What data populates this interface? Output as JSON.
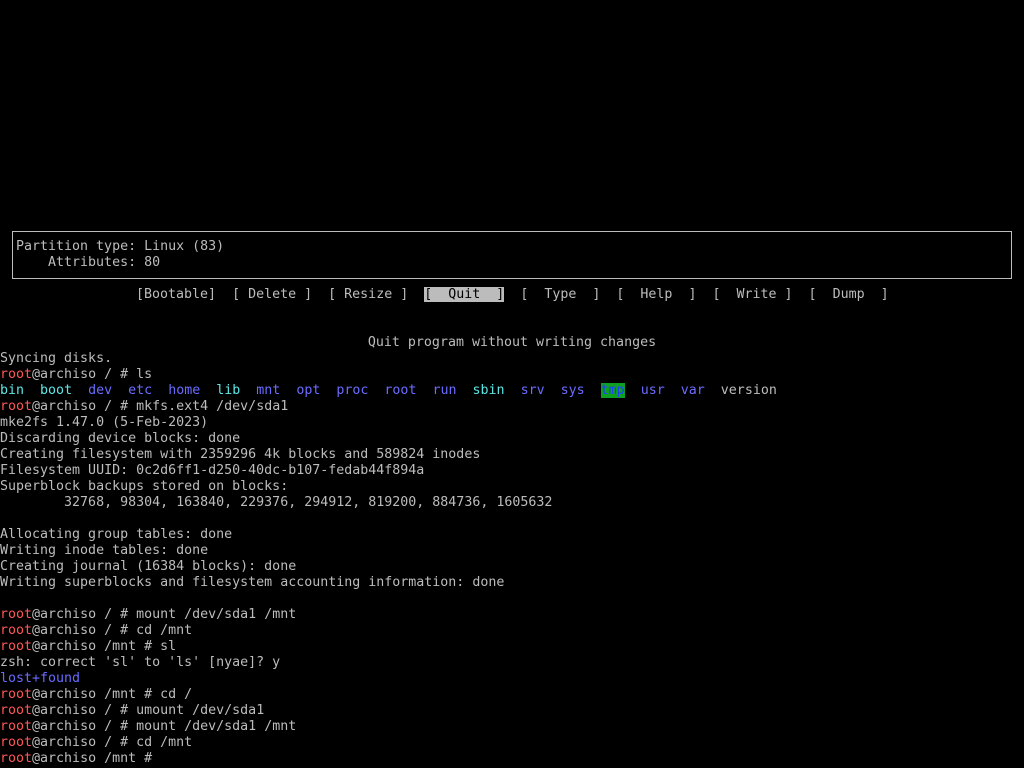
{
  "partition_info": {
    "type_line": "Partition type: Linux (83)",
    "attributes_line": "    Attributes: 80"
  },
  "menu": {
    "items": [
      "[Bootable]",
      "[ Delete ]",
      "[ Resize ]",
      "[  Quit  ]",
      "[  Type  ]",
      "[  Help  ]",
      "[  Write ]",
      "[  Dump  ]"
    ],
    "selected": "[  Quit  ]",
    "hint": "Quit program without writing changes"
  },
  "prompt": {
    "user": "root",
    "host_root": "@archiso / # ",
    "host_mnt": "@archiso /mnt # "
  },
  "terminal": {
    "syncing": "Syncing disks.",
    "cmd_ls": "ls",
    "ls_entries": [
      "bin",
      "boot",
      "dev",
      "etc",
      "home",
      "lib",
      "mnt",
      "opt",
      "proc",
      "root",
      "run",
      "sbin",
      "srv",
      "sys",
      "tmp",
      "usr",
      "var",
      "version"
    ],
    "cmd_mkfs": "mkfs.ext4 /dev/sda1",
    "mkfs_version": "mke2fs 1.47.0 (5-Feb-2023)",
    "discarding": "Discarding device blocks: done",
    "creating_fs": "Creating filesystem with 2359296 4k blocks and 589824 inodes",
    "fs_uuid": "Filesystem UUID: 0c2d6ff1-d250-40dc-b107-fedab44f894a",
    "superblock_header": "Superblock backups stored on blocks:",
    "superblock_list": "        32768, 98304, 163840, 229376, 294912, 819200, 884736, 1605632",
    "alloc_tables": "Allocating group tables: done",
    "writing_inodes": "Writing inode tables: done",
    "creating_journal": "Creating journal (16384 blocks): done",
    "writing_superblocks": "Writing superblocks and filesystem accounting information: done",
    "cmd_mount1": "mount /dev/sda1 /mnt",
    "cmd_cd_mnt1": "cd /mnt",
    "cmd_sl": "sl",
    "zsh_correct": "zsh: correct 'sl' to 'ls' [nyae]? y",
    "lost_found": "lost+found",
    "cmd_cd_root": "cd /",
    "cmd_umount": "umount /dev/sda1",
    "cmd_mount2": "mount /dev/sda1 /mnt",
    "cmd_cd_mnt2": "cd /mnt",
    "cmd_last": ""
  },
  "colors": {
    "background": "#000000",
    "foreground": "#bcbcbc",
    "prompt_user": "#ff5555",
    "directory": "#6b6bff",
    "symlink": "#5ee6e6",
    "tmp_bg": "#0ea020"
  }
}
